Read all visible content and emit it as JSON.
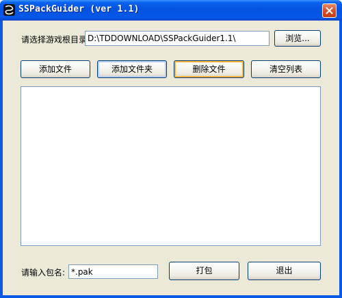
{
  "window": {
    "title": "SSPackGuider (ver 1.1)"
  },
  "icons": {
    "app": "app-icon",
    "close": "close-icon"
  },
  "game_dir": {
    "label": "请选择游戏根目录:",
    "value": "D:\\TDDOWNLOAD\\SSPackGuider1.1\\",
    "browse_label": "浏览..."
  },
  "actions": {
    "add_file": "添加文件",
    "add_folder": "添加文件夹",
    "delete_file": "删除文件",
    "clear_list": "清空列表"
  },
  "file_list": {
    "items": []
  },
  "package": {
    "label": "请输入包名:",
    "value": "*.pak",
    "pack_label": "打包",
    "exit_label": "退出"
  },
  "colors": {
    "titlebar": "#0452e0",
    "client_bg": "#ece9d8",
    "input_border": "#7f9db9",
    "hover_accent": "#f8b23a"
  }
}
